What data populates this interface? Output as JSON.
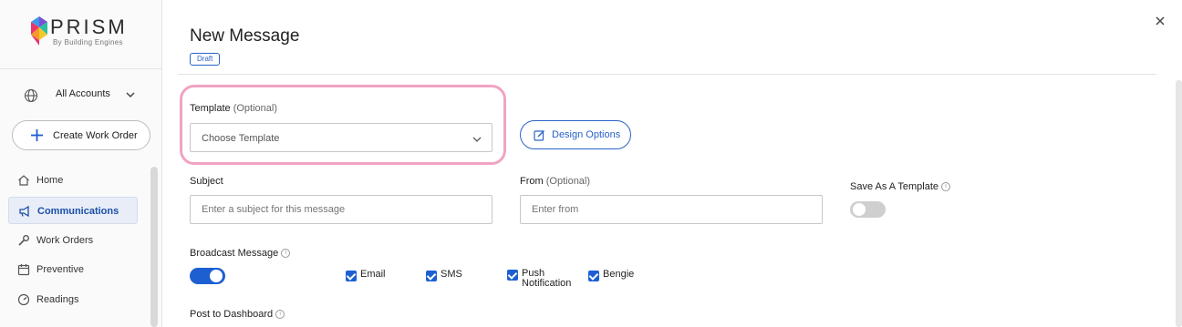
{
  "brand": {
    "name": "PRISM",
    "tagline": "By Building Engines"
  },
  "sidebar": {
    "account_selector": "All Accounts",
    "create_button": "Create Work Order",
    "items": [
      {
        "label": "Home",
        "icon": "home-icon"
      },
      {
        "label": "Communications",
        "icon": "megaphone-icon",
        "active": true
      },
      {
        "label": "Work Orders",
        "icon": "wrench-icon"
      },
      {
        "label": "Preventive",
        "icon": "calendar-icon"
      },
      {
        "label": "Readings",
        "icon": "gauge-icon"
      }
    ]
  },
  "form": {
    "title": "New Message",
    "status_badge": "Draft",
    "template": {
      "label": "Template",
      "optional": "(Optional)",
      "placeholder": "Choose Template"
    },
    "design_options": "Design Options",
    "subject": {
      "label": "Subject",
      "placeholder": "Enter a subject for this message"
    },
    "from": {
      "label": "From",
      "optional": "(Optional)",
      "placeholder": "Enter from"
    },
    "save_template": {
      "label": "Save As A Template",
      "enabled": false
    },
    "broadcast": {
      "label": "Broadcast Message",
      "enabled": true,
      "channels": [
        {
          "label": "Email",
          "checked": true
        },
        {
          "label": "SMS",
          "checked": true
        },
        {
          "label": "Push Notification",
          "checked": true
        },
        {
          "label": "Bengie",
          "checked": true
        }
      ]
    },
    "post_dashboard": {
      "label": "Post to Dashboard"
    }
  },
  "colors": {
    "accent": "#1d5fd1",
    "highlight": "#f1a3c4"
  }
}
